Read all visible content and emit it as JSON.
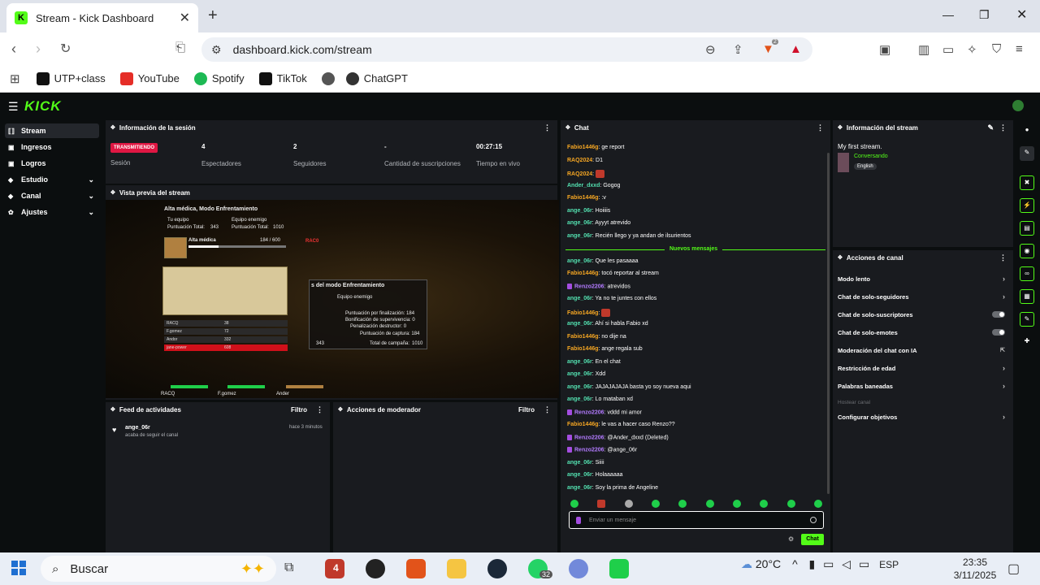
{
  "browser": {
    "tab_title": "Stream - Kick Dashboard",
    "url": "dashboard.kick.com/stream",
    "brave_count": "2",
    "bookmarks": [
      "UTP+class",
      "YouTube",
      "Spotify",
      "TikTok",
      "ChatGPT"
    ]
  },
  "app": {
    "logo": "KICK"
  },
  "sidebar": {
    "items": [
      {
        "label": "Stream",
        "icon": "stream-icon"
      },
      {
        "label": "Ingresos",
        "icon": "money-icon"
      },
      {
        "label": "Logros",
        "icon": "trophy-icon"
      },
      {
        "label": "Estudio",
        "icon": "studio-icon"
      },
      {
        "label": "Canal",
        "icon": "channel-icon"
      },
      {
        "label": "Ajustes",
        "icon": "gear-icon"
      }
    ]
  },
  "session": {
    "title": "Información de la sesión",
    "status": "TRANSMITIENDO",
    "status_label": "Sesión",
    "stats": [
      {
        "value": "4",
        "label": "Espectadores"
      },
      {
        "value": "2",
        "label": "Seguidores"
      },
      {
        "value": "-",
        "label": "Cantidad de suscripciones"
      },
      {
        "value": "00:27:15",
        "label": "Tiempo en vivo"
      }
    ]
  },
  "preview": {
    "title": "Vista previa del stream",
    "game_overlay": {
      "header": "Alta médica,  Modo Enfrentamiento",
      "team_label": "Tu equipo",
      "team_score_label": "Puntuación Total:",
      "team_score": "343",
      "enemy_label": "Equipo enemigo",
      "enemy_score_label": "Puntuación Total:",
      "enemy_score": "1010",
      "bar_label": "Alta médica",
      "bar_value": "184 / 600",
      "popup_title": "s del modo Enfrentamiento",
      "popup_team": "Equipo enemigo",
      "popup_rows": [
        "Puntuación por finalización: 184",
        "Bonificación de supervivencia: 0",
        "Penalización destructor: 0",
        "Puntuación de captura: 184"
      ],
      "popup_total_label": "Total de campaña:",
      "popup_total": "1010",
      "popup_left": "343",
      "tag": "RAC0",
      "scoreboard": [
        {
          "name": "RACQ",
          "score": "38"
        },
        {
          "name": "F.gomez",
          "score": "72"
        },
        {
          "name": "Andor",
          "score": "332"
        },
        {
          "name": "jane-power",
          "score": "608"
        }
      ],
      "bottom_players": [
        "RACQ",
        "F.gomez",
        "Ander"
      ]
    }
  },
  "feed": {
    "title": "Feed de actividades",
    "filter": "Filtro",
    "items": [
      {
        "user": "ange_06r",
        "action": "acaba de seguir el canal",
        "time": "hace 3 minutos"
      }
    ]
  },
  "moderator": {
    "title": "Acciones de moderador",
    "filter": "Filtro"
  },
  "chat": {
    "title": "Chat",
    "new_messages_label": "Nuevos mensajes",
    "messages_before": [
      {
        "user": "Fabio1446g",
        "text": "ge report",
        "cls": "u-fabio"
      },
      {
        "user": "RAQ2024",
        "text": "D1",
        "cls": "u-raq"
      },
      {
        "user": "RAQ2024",
        "text": "",
        "emote": true,
        "cls": "u-raq"
      },
      {
        "user": "Ander_dxxd",
        "text": "Gogog",
        "cls": "u-ander"
      },
      {
        "user": "Fabio1446g",
        "text": ":v",
        "cls": "u-fabio"
      },
      {
        "user": "ange_06r",
        "text": "Hoiiiis",
        "cls": "u-ange"
      },
      {
        "user": "ange_06r",
        "text": "Ayyyt atrevido",
        "cls": "u-ange"
      },
      {
        "user": "ange_06r",
        "text": "Recién llego y ya andan de ilsurientos",
        "cls": "u-ange"
      }
    ],
    "messages_after": [
      {
        "user": "ange_06r",
        "text": "Que les pasaaaa",
        "cls": "u-ange"
      },
      {
        "user": "Fabio1446g",
        "text": "tocó reportar al stream",
        "cls": "u-fabio"
      },
      {
        "user": "Renzo2206",
        "text": "atrevidos",
        "cls": "u-renzo",
        "badge": true
      },
      {
        "user": "ange_06r",
        "text": "Ya no te juntes con ellos",
        "cls": "u-ange"
      },
      {
        "user": "Fabio1446g",
        "text": "",
        "emote": true,
        "cls": "u-fabio"
      },
      {
        "user": "ange_06r",
        "text": "Ahí si habla Fabio xd",
        "cls": "u-ange"
      },
      {
        "user": "Fabio1446g",
        "text": "no dije na",
        "cls": "u-fabio"
      },
      {
        "user": "Fabio1446g",
        "text": "ange regala sub",
        "cls": "u-fabio"
      },
      {
        "user": "ange_06r",
        "text": "En el chat",
        "cls": "u-ange"
      },
      {
        "user": "ange_06r",
        "text": "Xdd",
        "cls": "u-ange"
      },
      {
        "user": "ange_06r",
        "text": "JAJAJAJAJA basta yo soy nueva aqui",
        "cls": "u-ange"
      },
      {
        "user": "ange_06r",
        "text": "Lo mataban xd",
        "cls": "u-ange"
      },
      {
        "user": "Renzo2206",
        "text": "vddd mi amor",
        "cls": "u-renzo",
        "badge": true
      },
      {
        "user": "Fabio1446g",
        "text": "le vas a hacer caso Renzo??",
        "cls": "u-fabio"
      },
      {
        "user": "Renzo2206",
        "text": "@Ander_dxxd (Deleted)",
        "cls": "u-renzo",
        "badge": true
      },
      {
        "user": "Renzo2206",
        "text": "@ange_06r",
        "cls": "u-renzo",
        "badge": true
      },
      {
        "user": "ange_06r",
        "text": "Siiii",
        "cls": "u-ange"
      },
      {
        "user": "ange_06r",
        "text": "Holaaaaaa",
        "cls": "u-ange"
      },
      {
        "user": "ange_06r",
        "text": "Soy la prima de Angeline",
        "cls": "u-ange"
      }
    ],
    "input_placeholder": "Enviar un mensaje",
    "send_label": "Chat"
  },
  "stream_info": {
    "title": "Información del stream",
    "stream_title": "My first stream.",
    "category": "Conversando",
    "language": "English"
  },
  "channel_actions": {
    "title": "Acciones de canal",
    "items": [
      {
        "label": "Modo lento",
        "control": "chevron"
      },
      {
        "label": "Chat de solo-seguidores",
        "control": "chevron"
      },
      {
        "label": "Chat de solo-suscriptores",
        "control": "toggle"
      },
      {
        "label": "Chat de solo-emotes",
        "control": "toggle"
      },
      {
        "label": "Moderación del chat con IA",
        "control": "external"
      },
      {
        "label": "Restricción de edad",
        "control": "chevron"
      },
      {
        "label": "Palabras baneadas",
        "control": "chevron"
      },
      {
        "label": "Hostear canal",
        "control": "none",
        "disabled": true
      },
      {
        "label": "Configurar objetivos",
        "control": "chevron"
      }
    ]
  },
  "taskbar": {
    "search_placeholder": "Buscar",
    "weather": "20°C",
    "lang": "ESP",
    "time": "23:35",
    "date": "3/11/2025",
    "whatsapp_badge": "32",
    "app_badge": "4"
  }
}
